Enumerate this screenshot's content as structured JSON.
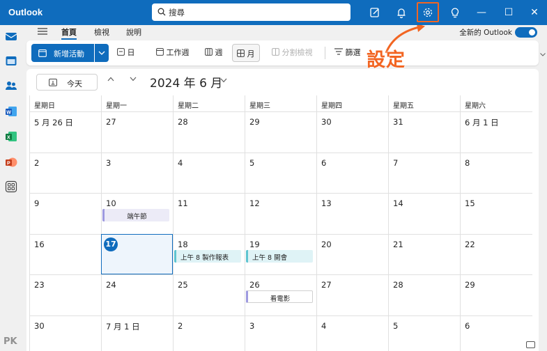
{
  "app": {
    "title": "Outlook"
  },
  "search": {
    "placeholder": "搜尋"
  },
  "titlebar_icons": [
    "compose-note-icon",
    "bell-icon",
    "gear-icon",
    "lightbulb-icon"
  ],
  "window_controls": {
    "minimize": "—",
    "maximize": "☐",
    "close": "✕"
  },
  "left_rail": [
    "mail-icon",
    "calendar-icon",
    "people-icon",
    "word-icon",
    "excel-icon",
    "powerpoint-icon",
    "apps-icon"
  ],
  "menu": {
    "items": [
      "首頁",
      "檢視",
      "說明"
    ],
    "active": "首頁",
    "new_outlook_label": "全新的 Outlook",
    "new_outlook_on": true
  },
  "toolbar": {
    "new_event": "新增活動",
    "views": [
      {
        "label": "日",
        "icon": "day-view-icon"
      },
      {
        "label": "工作週",
        "icon": "workweek-view-icon"
      },
      {
        "label": "週",
        "icon": "week-view-icon"
      },
      {
        "label": "月",
        "icon": "month-view-icon",
        "selected": true
      },
      {
        "label": "分割檢視",
        "icon": "split-view-icon",
        "disabled": true
      }
    ],
    "filter": "篩選"
  },
  "annotation": {
    "label": "設定",
    "color": "#f26522"
  },
  "calendar": {
    "today_label": "今天",
    "month_title": "2024 年 6 月",
    "weekdays": [
      "星期日",
      "星期一",
      "星期二",
      "星期三",
      "星期四",
      "星期五",
      "星期六"
    ],
    "weeks": [
      [
        "5 月 26 日",
        "27",
        "28",
        "29",
        "30",
        "31",
        "6 月 1 日"
      ],
      [
        "2",
        "3",
        "4",
        "5",
        "6",
        "7",
        "8"
      ],
      [
        "9",
        "10",
        "11",
        "12",
        "13",
        "14",
        "15"
      ],
      [
        "16",
        "17",
        "18",
        "19",
        "20",
        "21",
        "22"
      ],
      [
        "23",
        "24",
        "25",
        "26",
        "27",
        "28",
        "29"
      ],
      [
        "30",
        "7 月 1 日",
        "2",
        "3",
        "4",
        "5",
        "6"
      ]
    ],
    "today": "17",
    "events": [
      {
        "week": 2,
        "day": 1,
        "label": "端午節",
        "style": "purple"
      },
      {
        "week": 3,
        "day": 2,
        "label": "上午 8 製作報表",
        "style": "teal"
      },
      {
        "week": 3,
        "day": 3,
        "label": "上午 8 開會",
        "style": "teal"
      },
      {
        "week": 4,
        "day": 3,
        "label": "看電影",
        "style": "white"
      }
    ]
  },
  "watermark": "PK",
  "colors": {
    "brand": "#0f6cbd",
    "accent_annotation": "#f26522"
  }
}
